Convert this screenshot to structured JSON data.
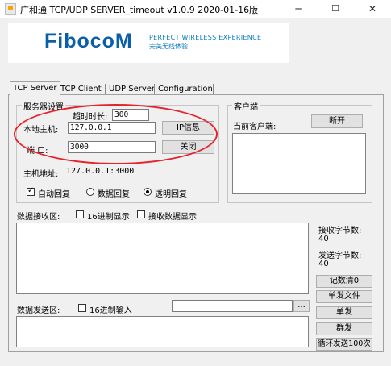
{
  "window": {
    "title": "广和通 TCP/UDP SERVER_timeout v1.0.9 2020-01-16版",
    "controls": {
      "minimize": "─",
      "maximize": "☐",
      "close": "✕"
    }
  },
  "banner": {
    "logo": "FibocoM",
    "slogan_en": "PERFECT WIRELESS EXPERIENCE",
    "slogan_cn": "完美无线体验"
  },
  "tabs": [
    "TCP Server",
    "TCP Client",
    "UDP Server",
    "Configuration"
  ],
  "server": {
    "group_label": "服务器设置",
    "timeout_label": "超时时长:",
    "timeout_value": "300",
    "host_label": "本地主机:",
    "host_value": "127.0.0.1",
    "ip_info_button": "IP信息",
    "port_label": "端  口:",
    "port_value": "3000",
    "close_button": "关闭",
    "host_address_label": "主机地址:",
    "host_address_value": "127.0.0.1:3000",
    "auto_reply": "自动回复",
    "data_reply": "数据回复",
    "transparent_reply": "透明回复"
  },
  "client": {
    "group_label": "客户端",
    "current_label": "当前客户端:",
    "disconnect_button": "断开"
  },
  "receive": {
    "label": "数据接收区:",
    "hex_display": "16进制显示",
    "recv_display": "接收数据显示",
    "recv_bytes_label": "接收字节数:",
    "recv_bytes_value": "40",
    "send_bytes_label": "发送字节数:",
    "send_bytes_value": "40"
  },
  "send": {
    "label": "数据发送区:",
    "hex_input": "16进制输入",
    "browse_button": "...",
    "clear_count_button": "记数清0",
    "send_file_button": "单发文件",
    "send_button": "单发",
    "broadcast_button": "群发",
    "loop_send_button": "循环发送100次"
  }
}
